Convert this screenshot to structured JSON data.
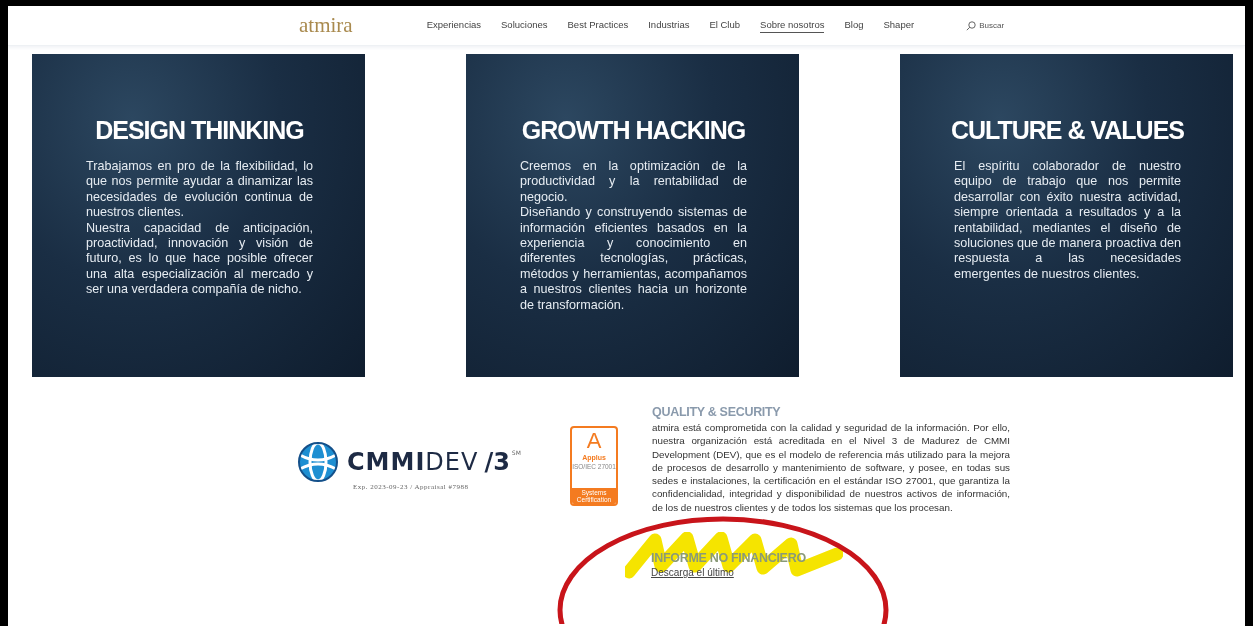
{
  "header": {
    "logo": "atmira",
    "nav": [
      {
        "label": "Experiencias",
        "selected": false
      },
      {
        "label": "Soluciones",
        "selected": false
      },
      {
        "label": "Best Practices",
        "selected": false
      },
      {
        "label": "Industrias",
        "selected": false
      },
      {
        "label": "El Club",
        "selected": false
      },
      {
        "label": "Sobre nosotros",
        "selected": true
      },
      {
        "label": "Blog",
        "selected": false
      },
      {
        "label": "Shaper",
        "selected": false
      }
    ],
    "search": {
      "placeholder": "Buscar"
    }
  },
  "cards": [
    {
      "title": "DESIGN THINKING",
      "paragraphs": [
        "Trabajamos en pro de la flexibilidad, lo que nos permite ayudar a dinamizar las necesidades de evolución continua de nuestros clientes.",
        "Nuestra capacidad de anticipación, proactividad, innovación y visión de futuro, es lo que hace posible ofrecer una alta especialización al mercado y ser una verdadera compañía de nicho."
      ]
    },
    {
      "title": "GROWTH HACKING",
      "paragraphs": [
        "Creemos en la optimización de la productividad y la rentabilidad de negocio.",
        "Diseñando y construyendo sistemas de información eficientes basados en la experiencia y conocimiento en diferentes tecnologías, prácticas, métodos y herramientas, acompañamos a nuestros clientes hacia un horizonte de transformación."
      ]
    },
    {
      "title": "CULTURE & VALUES",
      "paragraphs": [
        "El espíritu colaborador de nuestro equipo de trabajo que nos permite desarrollar con éxito nuestra actividad, siempre orientada a resultados y a la rentabilidad, mediantes el diseño de soluciones que de manera proactiva den respuesta a las necesidades emergentes de nuestros clientes."
      ]
    }
  ],
  "quality": {
    "cmmi": {
      "name": "CMMI",
      "suffix": "DEV",
      "level": "/3",
      "mark": "SM",
      "caption": "Exp. 2023-09-23 / Appraisal #7988"
    },
    "badge": {
      "letter": "A",
      "brand": "Applus",
      "standard": "ISO/IEC 27001",
      "footer": "Systems Certification"
    },
    "title": "QUALITY & SECURITY",
    "text": "atmira está comprometida con la calidad y seguridad de la información. Por ello, nuestra organización está acreditada en el Nivel 3 de Madurez de CMMI Development (DEV), que es el modelo de referencia más utilizado para la mejora de procesos de desarrollo y mantenimiento de software, y posee, en todas sus sedes e instalaciones, la certificación en el estándar ISO 27001, que garantiza la confidencialidad, integridad y disponibilidad de nuestros activos de información, de los de nuestros clientes y de todos los sistemas que los procesan."
  },
  "report": {
    "title": "INFORME NO FINANCIERO",
    "link": "Descarga el último"
  }
}
